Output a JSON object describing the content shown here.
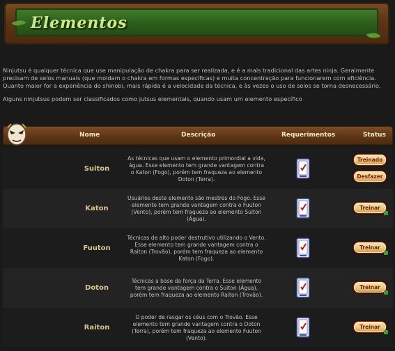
{
  "header": {
    "title": "Elementos"
  },
  "intro": {
    "paragraph1": "Ninjutsu é qualquer técnica que use manipulação de chakra para ser realizada, e é a mais tradicional das artes ninja. Geralmente precisam de selos manuais (que moldam o chakra em formas específicas) e muita concentração para funcionarem com eficiência. Quanto maior for a experiência do shinobi, mais rápida é a velocidade da técnica, e às vezes o uso de selos se torna desnecessário.",
    "paragraph2": "Alguns ninjutsus podem ser classificados como jutsus elementais, quando usam um elemento específico"
  },
  "table": {
    "headers": {
      "nome": "Nome",
      "descricao": "Descrição",
      "requerimentos": "Requerimentos",
      "status": "Status"
    },
    "rows": [
      {
        "nome": "Suiton",
        "descricao": "As técnicas que usam o elemento primordial a vida, água. Esse elemento tem grande vantagem contra o Katon (Fogo), porém tem fraqueza ao elemento Doton (Terra).",
        "buttons": [
          "Treinado",
          "Desfazer"
        ]
      },
      {
        "nome": "Katon",
        "descricao": "Usuários deste elemento são mestres do Fogo. Esse elemento tem grande vantagem contra o Fuuton (Vento), porém tem fraqueza ao elemento Suiton (Água).",
        "buttons": [
          "Treinar"
        ]
      },
      {
        "nome": "Fuuton",
        "descricao": "Técnicas de alto poder destrutivo utilizando o Vento. Esse elemento tem grande vantagem contra o Raiton (Trovão), porém tem fraqueza ao elemento Katon (Fogo).",
        "buttons": [
          "Treinar"
        ]
      },
      {
        "nome": "Doton",
        "descricao": "Técnicas a base da força da Terra. Esse elemento tem grande vantagem contra o Suiton (Água), porém tem fraqueza ao elemento Raiton (Trovão).",
        "buttons": [
          "Treinar"
        ]
      },
      {
        "nome": "Raiton",
        "descricao": "O poder de rasgar os céus com o Trovão. Esse elemento tem grande vantagem contra o Doton (Terra), porém tem fraqueza ao elemento Fuuton (Vento).",
        "buttons": [
          "Treinar"
        ]
      }
    ]
  },
  "icons": {
    "header": "leaf-icon",
    "mask": "ninja-mask-icon",
    "requirement": "scroll-requirement-icon"
  }
}
